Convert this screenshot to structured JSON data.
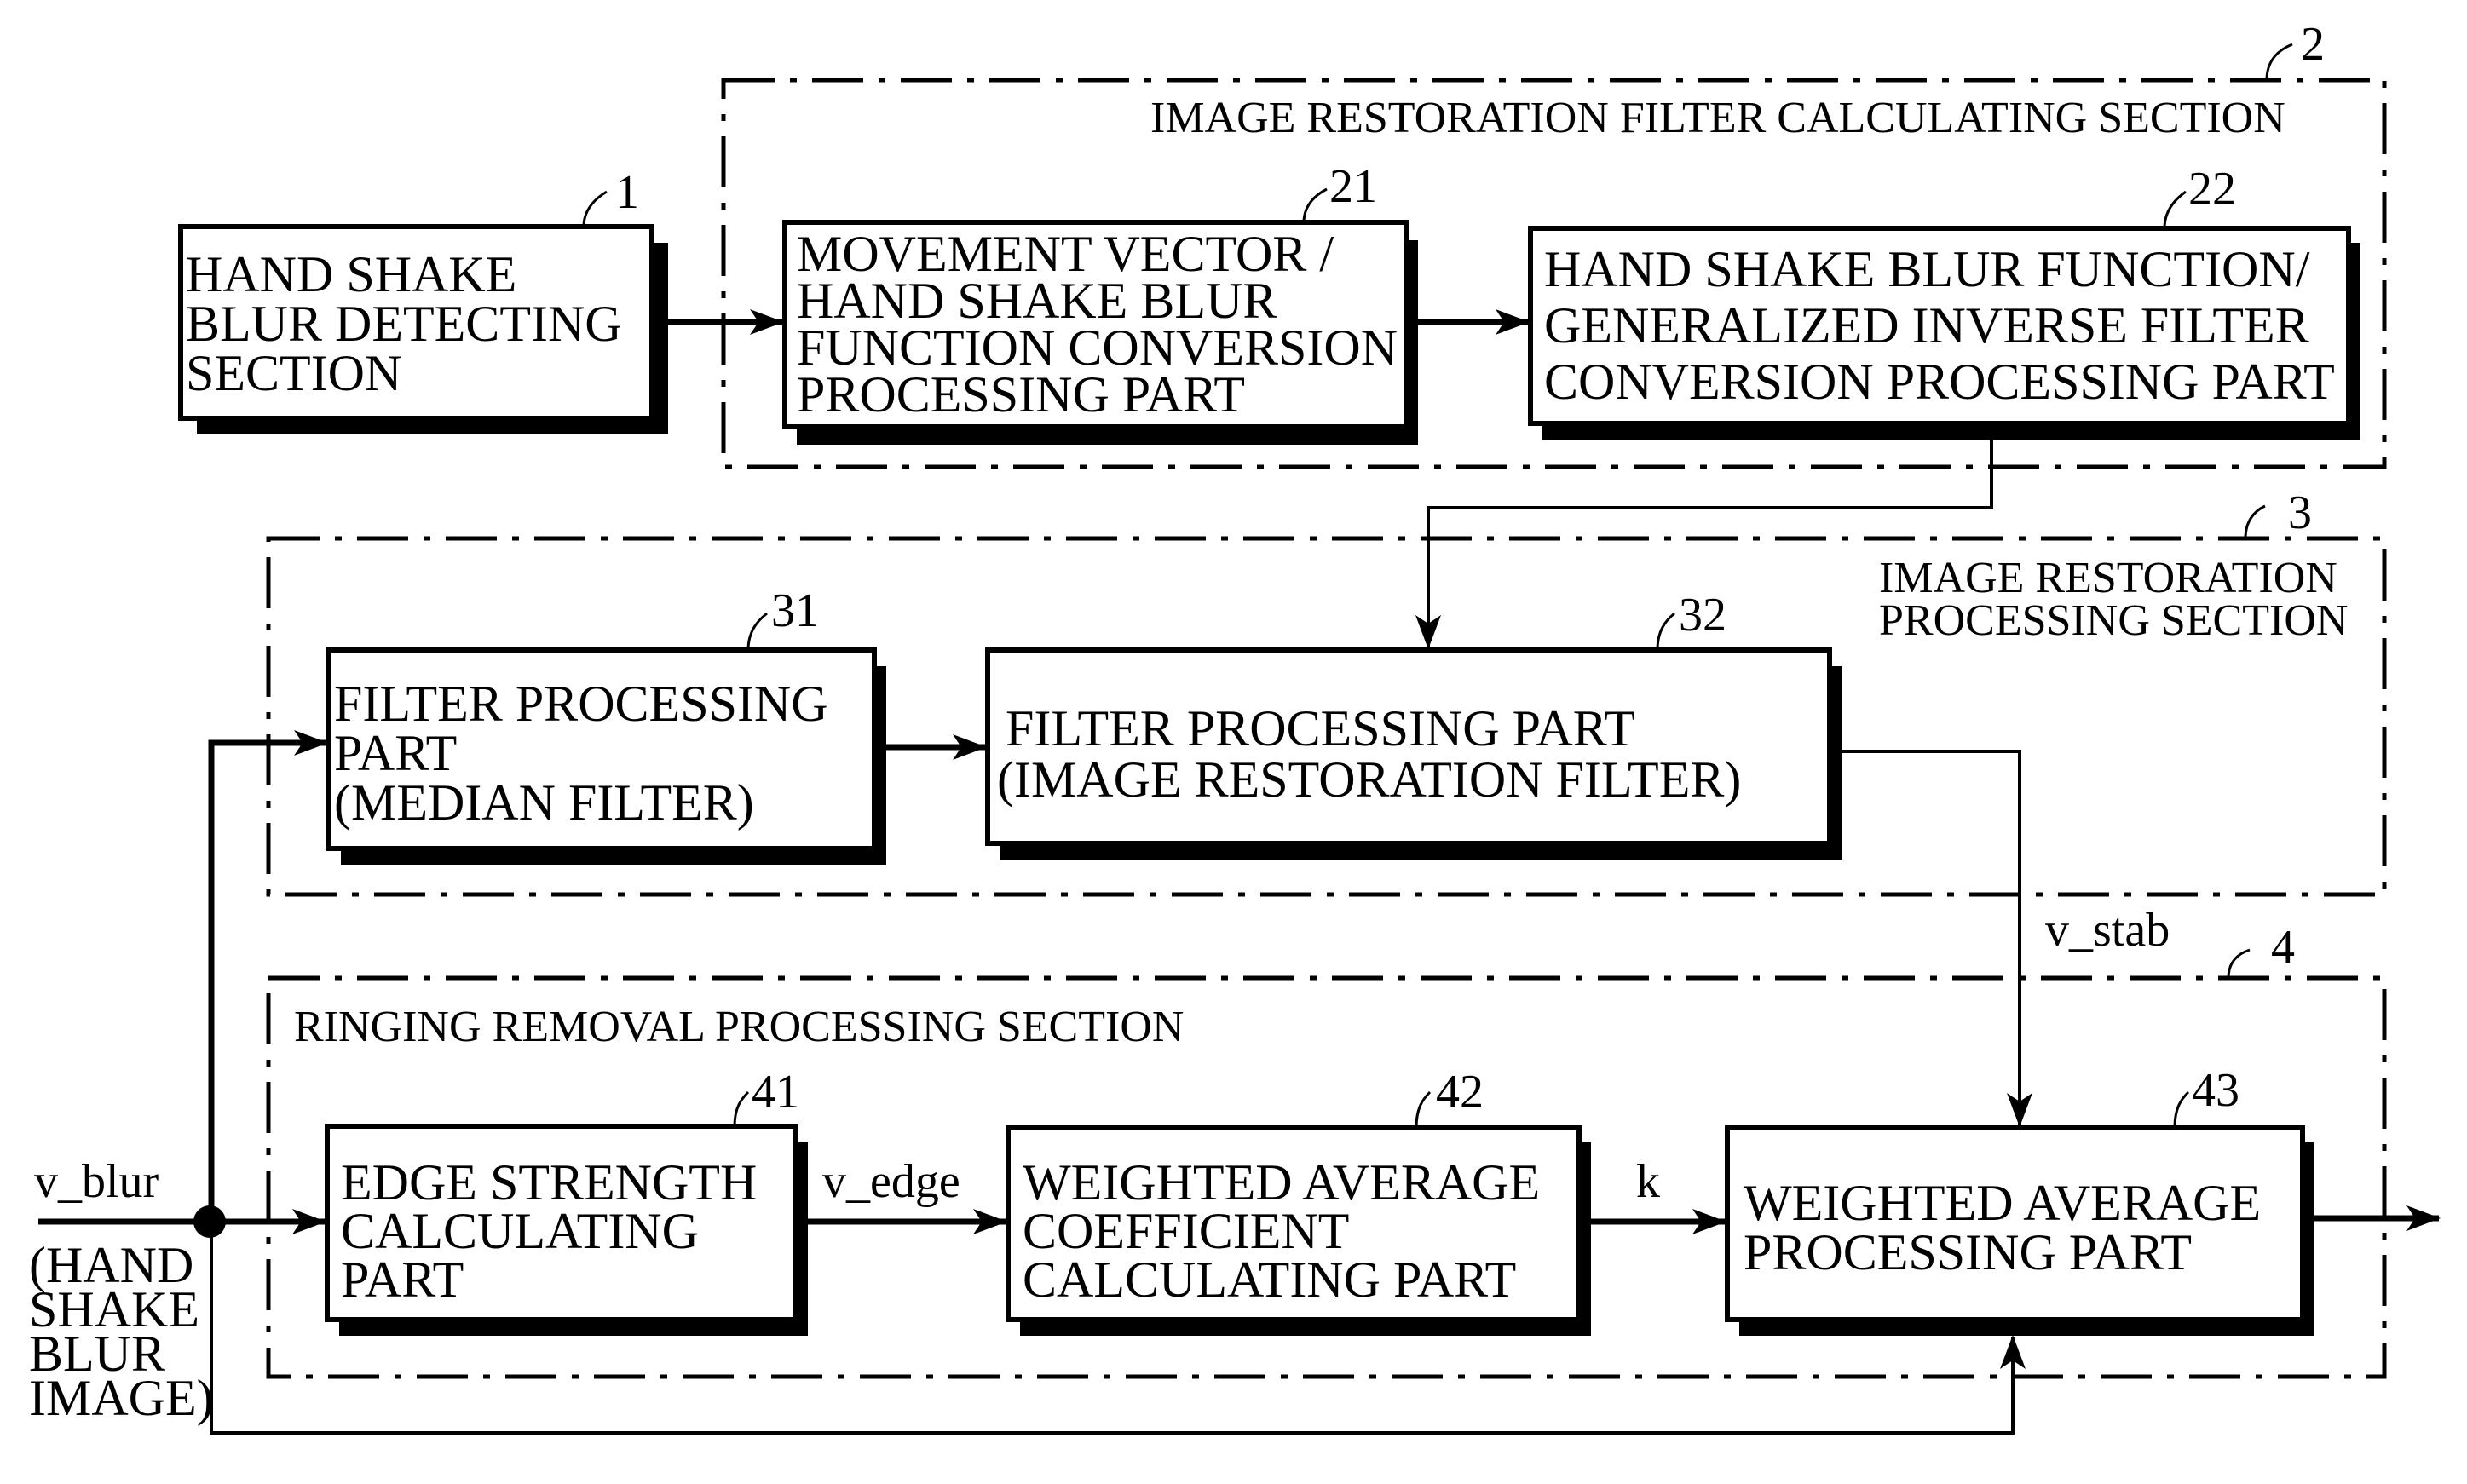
{
  "diagram": {
    "blocks": {
      "b1": {
        "ref": "1",
        "lines": [
          "HAND SHAKE",
          "BLUR DETECTING",
          "SECTION"
        ]
      },
      "b21": {
        "ref": "21",
        "lines": [
          "MOVEMENT VECTOR /",
          "HAND SHAKE BLUR",
          "FUNCTION CONVERSION",
          "PROCESSING PART"
        ]
      },
      "b22": {
        "ref": "22",
        "lines": [
          "HAND SHAKE BLUR FUNCTION/",
          "GENERALIZED INVERSE FILTER",
          "CONVERSION PROCESSING PART"
        ]
      },
      "b31": {
        "ref": "31",
        "lines": [
          "FILTER PROCESSING",
          "PART",
          "(MEDIAN  FILTER)"
        ]
      },
      "b32": {
        "ref": "32",
        "lines": [
          "FILTER PROCESSING  PART",
          "(IMAGE RESTORATION  FILTER)"
        ]
      },
      "b41": {
        "ref": "41",
        "lines": [
          "EDGE STRENGTH",
          "CALCULATING",
          "PART"
        ]
      },
      "b42": {
        "ref": "42",
        "lines": [
          "WEIGHTED AVERAGE",
          "COEFFICIENT",
          "CALCULATING PART"
        ]
      },
      "b43": {
        "ref": "43",
        "lines": [
          "WEIGHTED AVERAGE",
          "PROCESSING PART"
        ]
      }
    },
    "sections": {
      "s2": {
        "ref": "2",
        "lines": [
          "IMAGE RESTORATION FILTER CALCULATING SECTION"
        ]
      },
      "s3": {
        "ref": "3",
        "lines": [
          "IMAGE RESTORATION",
          "PROCESSING SECTION"
        ]
      },
      "s4": {
        "ref": "4",
        "lines": [
          "RINGING REMOVAL PROCESSING SECTION"
        ]
      }
    },
    "signals": {
      "v_blur": "v_blur",
      "v_blur_desc": [
        "(HAND",
        "SHAKE",
        "BLUR",
        "IMAGE)"
      ],
      "v_stab": "v_stab",
      "v_edge": "v_edge",
      "k": "k"
    }
  }
}
